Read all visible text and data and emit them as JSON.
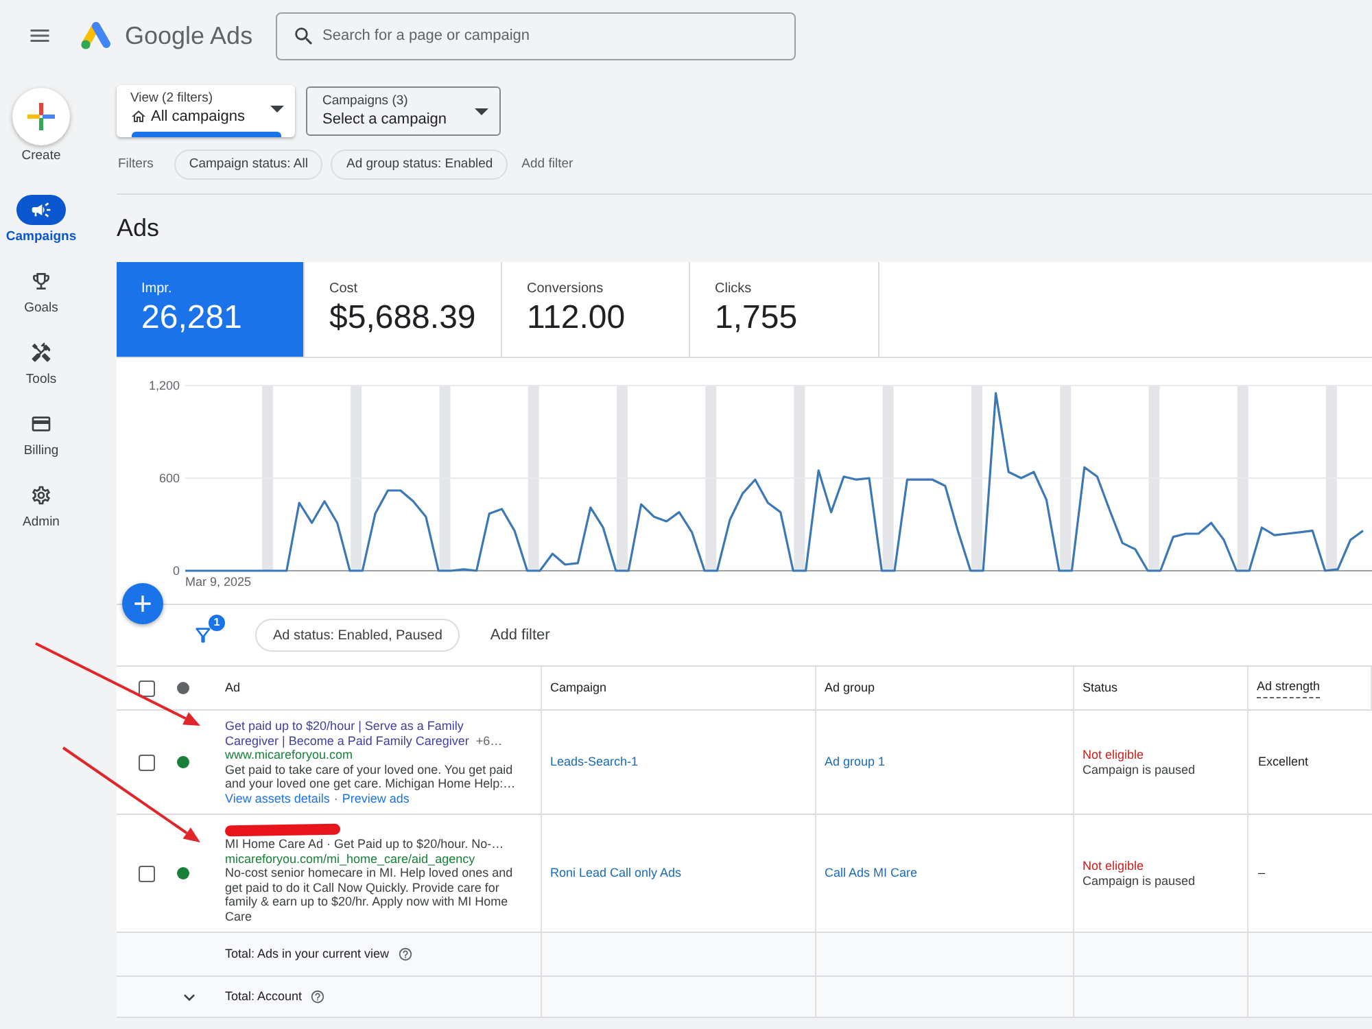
{
  "app": {
    "name": "Google Ads"
  },
  "search": {
    "placeholder": "Search for a page or campaign"
  },
  "create_button": {
    "label": "Create"
  },
  "sidebar": {
    "items": [
      {
        "label": "Campaigns",
        "kind": "campaigns",
        "selected": true
      },
      {
        "label": "Goals",
        "kind": "goals",
        "selected": false
      },
      {
        "label": "Tools",
        "kind": "tools",
        "selected": false
      },
      {
        "label": "Billing",
        "kind": "billing",
        "selected": false
      },
      {
        "label": "Admin",
        "kind": "admin",
        "selected": false
      }
    ]
  },
  "view_picker": {
    "caption": "View (2 filters)",
    "value": "All campaigns"
  },
  "campaign_picker": {
    "caption": "Campaigns (3)",
    "value": "Select a campaign"
  },
  "filters": {
    "label": "Filters",
    "chips": [
      "Campaign status: All",
      "Ad group status: Enabled"
    ],
    "add_label": "Add filter"
  },
  "page_title": "Ads",
  "metrics": [
    {
      "label": "Impr.",
      "value": "26,281",
      "selected": true
    },
    {
      "label": "Cost",
      "value": "$5,688.39",
      "selected": false
    },
    {
      "label": "Conversions",
      "value": "112.00",
      "selected": false
    },
    {
      "label": "Clicks",
      "value": "1,755",
      "selected": false
    }
  ],
  "chart_data": {
    "type": "line",
    "series": [
      {
        "color": "#3b78b5",
        "values": [
          0,
          0,
          0,
          0,
          0,
          0,
          0,
          0,
          0,
          440,
          310,
          450,
          310,
          0,
          0,
          370,
          520,
          520,
          450,
          350,
          0,
          0,
          10,
          0,
          370,
          400,
          260,
          0,
          0,
          110,
          40,
          50,
          410,
          280,
          0,
          0,
          430,
          350,
          320,
          380,
          250,
          0,
          0,
          330,
          500,
          590,
          440,
          380,
          0,
          0,
          650,
          380,
          610,
          590,
          600,
          0,
          0,
          590,
          590,
          590,
          550,
          260,
          0,
          0,
          1150,
          640,
          600,
          640,
          460,
          0,
          0,
          670,
          610,
          390,
          180,
          140,
          0,
          0,
          220,
          240,
          240,
          310,
          200,
          0,
          0,
          280,
          230,
          240,
          250,
          260,
          0,
          10,
          200,
          260
        ]
      }
    ],
    "ylim": [
      0,
      1200
    ],
    "yticks": [
      {
        "value": 0,
        "label": "0"
      },
      {
        "value": 600,
        "label": "600"
      },
      {
        "value": 1200,
        "label": "1,200"
      }
    ],
    "annotations": [
      "Mar 9, 2025"
    ]
  },
  "table_filters": {
    "count": "1",
    "chips": [
      "Ad status: Enabled, Paused"
    ],
    "add_label": "Add filter"
  },
  "table": {
    "select_all": {
      "checked": false
    },
    "columns": [
      "Ad",
      "Campaign",
      "Ad group",
      "Status",
      "Ad strength"
    ],
    "rows": [
      {
        "checked": false,
        "color": "#188038",
        "ad": {
          "kind": "search",
          "redacted": false,
          "headline": "Get paid up to $20/hour | Serve as a Family Caregiver | Become a Paid Family Caregiver",
          "more": "+6…",
          "url": "www.micareforyou.com",
          "description": "Get paid to take care of your loved one. You get paid and your loved one get care. Michigan Home Help:…",
          "links": [
            "View assets details",
            "Preview ads"
          ],
          "link_separator": "·"
        },
        "campaign": "Leads-Search-1",
        "ad_group": "Ad group 1",
        "status": "Not eligible",
        "status_reason": "Campaign is paused",
        "ad_strength": "Excellent"
      },
      {
        "checked": false,
        "color": "#188038",
        "ad": {
          "kind": "call",
          "redacted": true,
          "headline": "MI Home Care Ad · Get Paid up to $20/hour. No-…",
          "url": "micareforyou.com/mi_home_care/aid_agency",
          "description": "No-cost senior homecare in MI. Help loved ones and get paid to do it Call Now Quickly. Provide care for family & earn up to $20/hr. Apply now with MI Home Care"
        },
        "campaign": "Roni Lead Call only Ads",
        "ad_group": "Call Ads MI Care",
        "status": "Not eligible",
        "status_reason": "Campaign is paused",
        "ad_strength": "–"
      }
    ],
    "totals": [
      {
        "label": "Total: Ads in your current view",
        "expandable": false
      },
      {
        "label": "Total: Account",
        "expandable": true
      }
    ]
  }
}
